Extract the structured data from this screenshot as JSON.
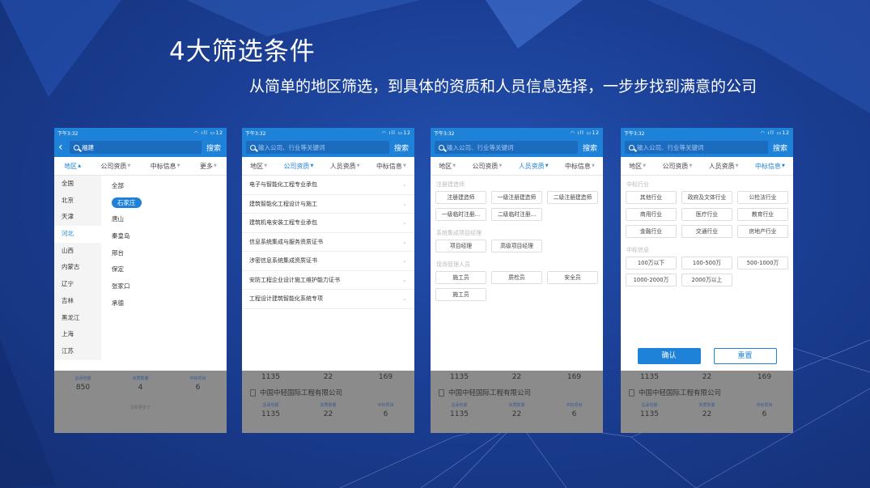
{
  "slide": {
    "title": "4大筛选条件",
    "subtitle": "从简单的地区筛选，到具体的资质和人员信息选择，一步步找到满意的公司"
  },
  "colors": {
    "brand": "#1e82d8",
    "background": "#1a3d8f"
  },
  "phones": [
    {
      "status_time": "下午3:32",
      "status_right": "12",
      "search_value": "福建",
      "search_placeholder": "",
      "search_button": "搜索",
      "filters": [
        "地区",
        "公司资质",
        "中标信息",
        "更多"
      ],
      "provinces": [
        "全国",
        "北京",
        "天津",
        "河北",
        "山西",
        "内蒙古",
        "辽宁",
        "吉林",
        "黑龙江",
        "上海",
        "江苏"
      ],
      "cities": [
        "全部",
        "石家庄",
        "唐山",
        "秦皇岛",
        "邢台",
        "保定",
        "张家口",
        "承德"
      ],
      "stats": [
        "850",
        "4",
        "6"
      ],
      "stat_labels": [
        "总承包额",
        "资质数量",
        "中标项目"
      ],
      "more": "没有更多了"
    },
    {
      "status_time": "下午3:32",
      "status_right": "12",
      "search_placeholder": "输入公司、行业等关键词",
      "search_button": "搜索",
      "filters": [
        "地区",
        "公司资质",
        "人员资质",
        "中标信息"
      ],
      "quals": [
        "电子与智能化工程专业承包",
        "建筑智能化工程设计与施工",
        "建筑机电安装工程专业承包",
        "信息系统集成与服务资质证书",
        "涉密信息系统集成资质证书",
        "安防工程企业设计施工维护能力证书",
        "工程设计建筑智能化系统专项"
      ],
      "stats": [
        "1135",
        "22",
        "169"
      ],
      "company": "中国中轻国际工程有限公司",
      "stat_labels": [
        "总承包额",
        "资质数量",
        "中标项目"
      ],
      "stats2": [
        "1135",
        "22",
        "6"
      ]
    },
    {
      "status_time": "下午3:32",
      "status_right": "12",
      "search_placeholder": "输入公司、行业等关键词",
      "search_button": "搜索",
      "filters": [
        "地区",
        "公司资质",
        "人员资质",
        "中标信息"
      ],
      "sections": [
        {
          "title": "注册建造师",
          "tags": [
            "注册建造师",
            "一级注册建造师",
            "二级注册建造师",
            "一级临时注册...",
            "二级临时注册..."
          ]
        },
        {
          "title": "系统集成项目经理",
          "tags": [
            "项目经理",
            "高级项目经理"
          ]
        },
        {
          "title": "现场管理人员",
          "tags": [
            "施工员",
            "质检员",
            "安全员",
            "施工员"
          ]
        }
      ],
      "stats": [
        "1135",
        "22",
        "169"
      ],
      "company": "中国中轻国际工程有限公司",
      "stat_labels": [
        "总承包额",
        "资质数量",
        "中标项目"
      ],
      "stats2": [
        "1135",
        "22",
        "6"
      ]
    },
    {
      "status_time": "下午3:32",
      "status_right": "12",
      "search_placeholder": "输入公司、行业等关键词",
      "search_button": "搜索",
      "filters": [
        "地区",
        "公司资质",
        "人员资质",
        "中标信息"
      ],
      "sections": [
        {
          "title": "中标行业",
          "tags": [
            "其他行业",
            "政府及文体行业",
            "公检法行业",
            "商用行业",
            "医疗行业",
            "教育行业",
            "金融行业",
            "交通行业",
            "房地产行业"
          ]
        },
        {
          "title": "中标信息",
          "tags": [
            "100万以下",
            "100-500万",
            "500-1000万",
            "1000-2000万",
            "2000万以上"
          ]
        }
      ],
      "confirm": "确认",
      "reset": "重置",
      "stats": [
        "1135",
        "22",
        "169"
      ],
      "company": "中国中轻国际工程有限公司",
      "stat_labels": [
        "总承包额",
        "资质数量",
        "中标项目"
      ],
      "stats2": [
        "1135",
        "22",
        "6"
      ]
    }
  ]
}
